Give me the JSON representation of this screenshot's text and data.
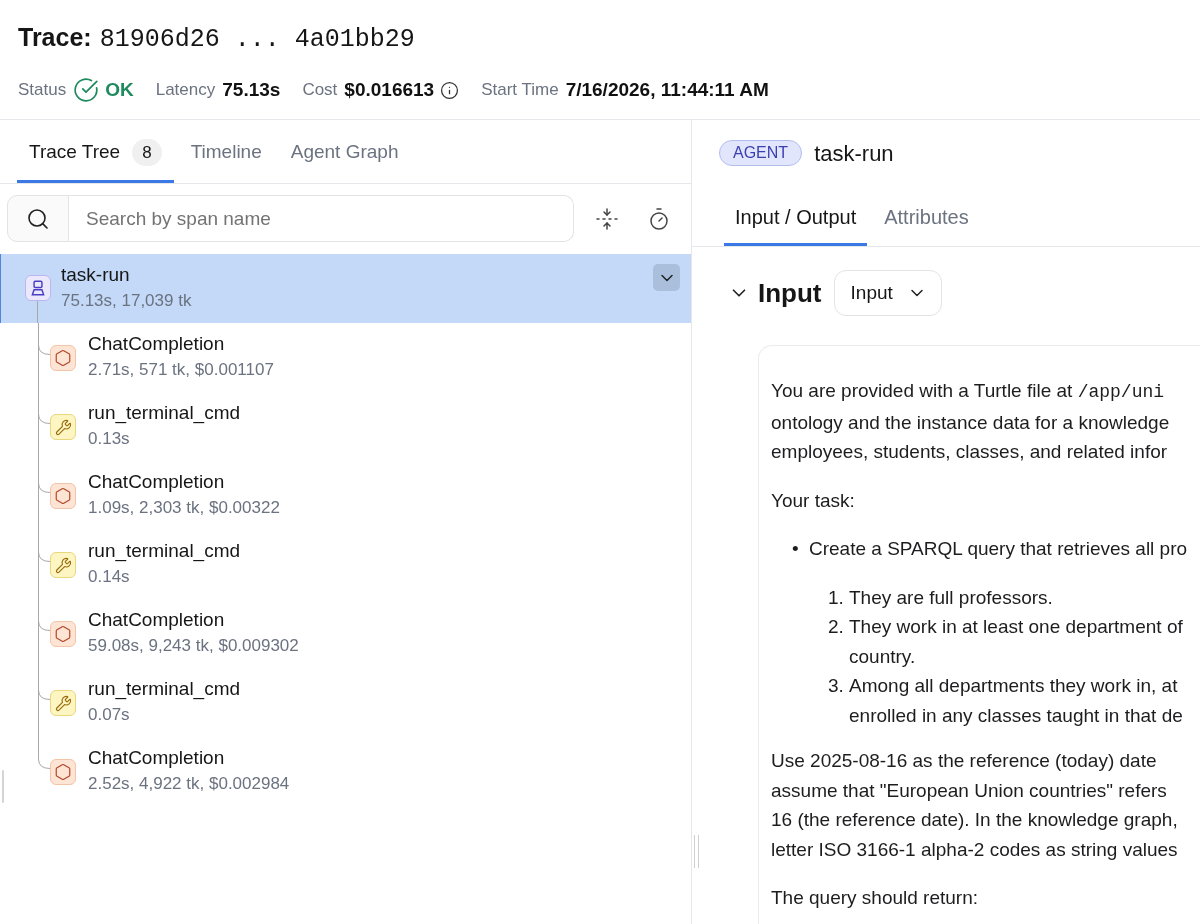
{
  "header": {
    "label": "Trace:",
    "trace_id": "81906d26 ... 4a01bb29"
  },
  "summary": [
    {
      "kind": "status",
      "label": "Status",
      "value": "OK"
    },
    {
      "kind": "metric",
      "label": "Latency",
      "value": "75.13s"
    },
    {
      "kind": "cost",
      "label": "Cost",
      "value": "$0.016613"
    },
    {
      "kind": "metric",
      "label": "Start Time",
      "value": "7/16/2026, 11:44:11 AM"
    }
  ],
  "left_panel": {
    "tabs": [
      {
        "label": "Trace Tree",
        "badge": "8",
        "selected": true
      },
      {
        "label": "Timeline",
        "selected": false
      },
      {
        "label": "Agent Graph",
        "selected": false
      }
    ],
    "search": {
      "placeholder": "Search by span name"
    },
    "tree": {
      "kind": "agent",
      "name": "task-run",
      "meta": "75.13s, 17,039 tk",
      "selected": true,
      "expanded": true,
      "children": [
        {
          "kind": "llm",
          "name": "ChatCompletion",
          "meta": "2.71s, 571 tk, $0.001107",
          "selected": false
        },
        {
          "kind": "tool",
          "name": "run_terminal_cmd",
          "meta": "0.13s",
          "selected": false
        },
        {
          "kind": "llm",
          "name": "ChatCompletion",
          "meta": "1.09s, 2,303 tk, $0.00322",
          "selected": false
        },
        {
          "kind": "tool",
          "name": "run_terminal_cmd",
          "meta": "0.14s",
          "selected": false
        },
        {
          "kind": "llm",
          "name": "ChatCompletion",
          "meta": "59.08s, 9,243 tk, $0.009302",
          "selected": false
        },
        {
          "kind": "tool",
          "name": "run_terminal_cmd",
          "meta": "0.07s",
          "selected": false
        },
        {
          "kind": "llm",
          "name": "ChatCompletion",
          "meta": "2.52s, 4,922 tk, $0.002984",
          "selected": false
        }
      ]
    }
  },
  "detail": {
    "badge": "AGENT",
    "span_name": "task-run",
    "tabs": [
      {
        "label": "Input / Output",
        "selected": true
      },
      {
        "label": "Attributes",
        "selected": false
      }
    ],
    "section": {
      "title": "Input",
      "expanded": true,
      "view_select": "Input"
    },
    "content": [
      {
        "kind": "paragraph",
        "lines": [
          {
            "text": "You are provided with a Turtle file at",
            "code": "/app/uni"
          },
          {
            "text": "ontology and the instance data for a knowledge"
          },
          {
            "text": "employees, students, classes, and related infor"
          }
        ]
      },
      {
        "kind": "paragraph",
        "lines": [
          {
            "text": "Your task:"
          }
        ]
      },
      {
        "kind": "bullet_list",
        "items": [
          {
            "marker": "•",
            "lines": [
              {
                "text": "Create a SPARQL query that retrieves all pro"
              }
            ],
            "children": [
              {
                "marker": "1.",
                "lines": [
                  {
                    "text": "They are full professors."
                  }
                ]
              },
              {
                "marker": "2.",
                "lines": [
                  {
                    "text": "They work in at least one department of"
                  },
                  {
                    "text": "country."
                  }
                ]
              },
              {
                "marker": "3.",
                "lines": [
                  {
                    "text": "Among all departments they work in, at"
                  },
                  {
                    "text": "enrolled in any classes taught in that de"
                  }
                ]
              }
            ]
          }
        ]
      },
      {
        "kind": "paragraph",
        "lines": [
          {
            "text": "Use 2025-08-16 as the reference (today) date"
          },
          {
            "text": "assume that \"European Union countries\" refers"
          },
          {
            "text": "16 (the reference date). In the knowledge graph,"
          },
          {
            "text": "letter ISO 3166-1 alpha-2 codes as string values"
          }
        ]
      },
      {
        "kind": "paragraph",
        "lines": [
          {
            "text": "The query should return:"
          }
        ]
      }
    ]
  }
}
